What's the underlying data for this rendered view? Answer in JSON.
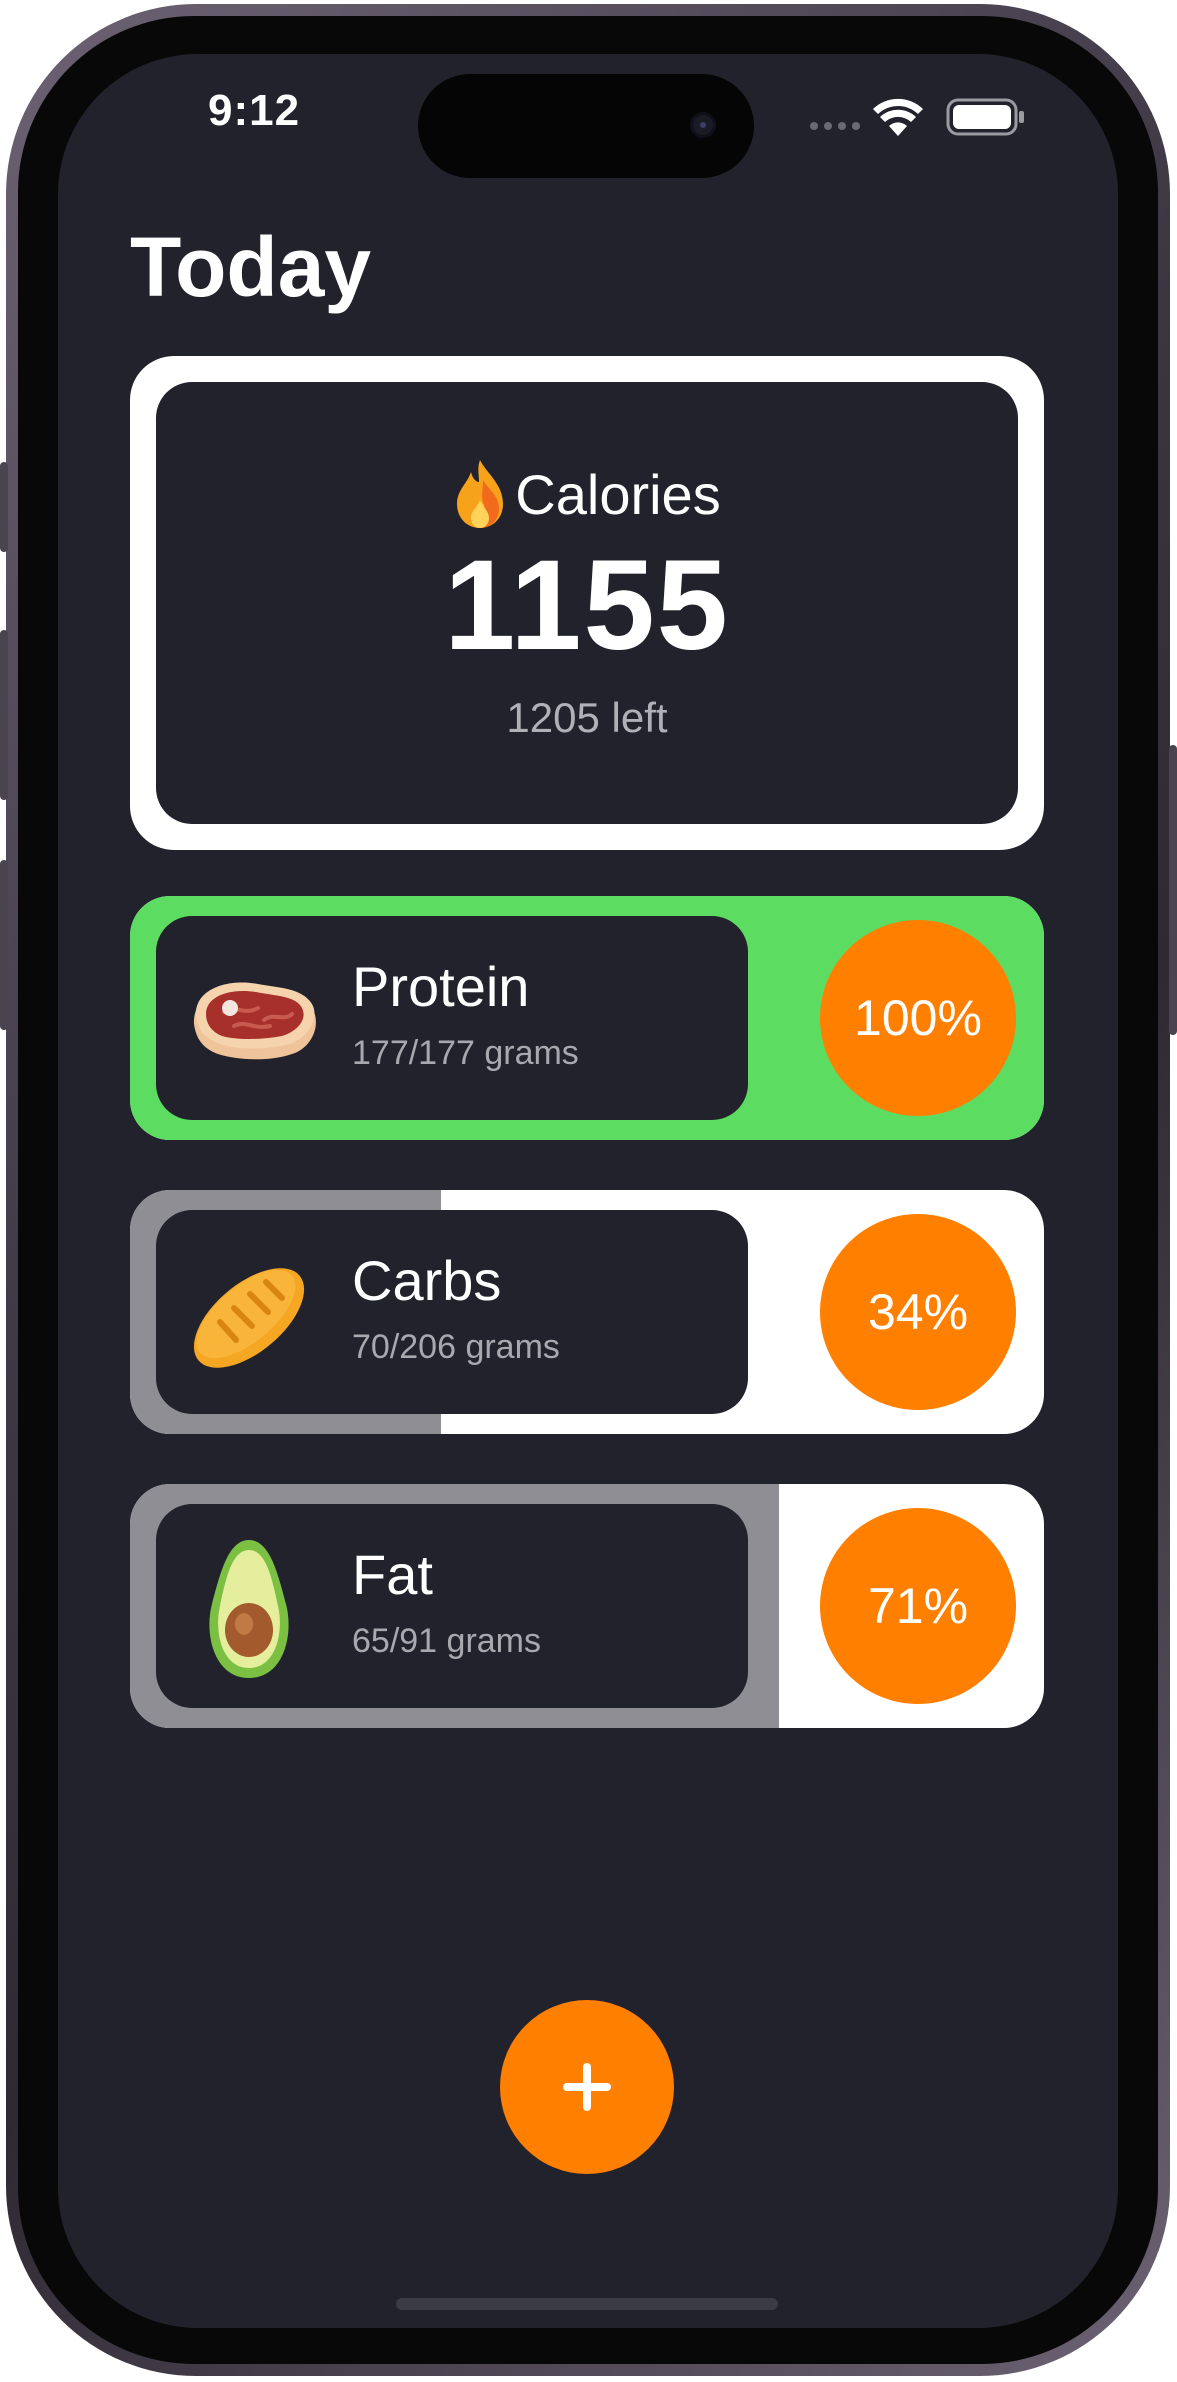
{
  "status_bar": {
    "time": "9:12",
    "signal_icon": "signal-dots-icon",
    "wifi_icon": "wifi-icon",
    "battery_icon": "battery-icon"
  },
  "page": {
    "title": "Today"
  },
  "calories": {
    "icon": "flame-icon",
    "title": "Calories",
    "value": "1155",
    "left_text": "1205 left"
  },
  "macros": [
    {
      "id": "protein",
      "icon": "steak-icon",
      "name": "Protein",
      "amount": "177/177 grams",
      "percent_label": "100%",
      "progress": 1.0,
      "fill_color": "#5cdc60"
    },
    {
      "id": "carbs",
      "icon": "bread-icon",
      "name": "Carbs",
      "amount": "70/206 grams",
      "percent_label": "34%",
      "progress": 0.34,
      "fill_color": "#8e8e94"
    },
    {
      "id": "fat",
      "icon": "avocado-icon",
      "name": "Fat",
      "amount": "65/91 grams",
      "percent_label": "71%",
      "progress": 0.71,
      "fill_color": "#8e8e94"
    }
  ],
  "add_button": {
    "icon": "plus-icon"
  },
  "colors": {
    "background": "#22222c",
    "accent": "#ff7f00",
    "protein_complete": "#5cdc60",
    "track": "#ffffff",
    "progress_gray": "#8e8e94"
  }
}
